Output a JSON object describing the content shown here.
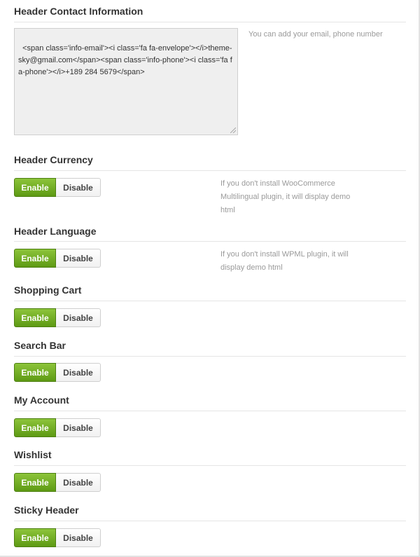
{
  "contact": {
    "title": "Header Contact Information",
    "textarea_value": "<span class='info-email'><i class='fa fa-envelope'></i>theme-sky@gmail.com</span><span class='info-phone'><i class='fa fa-phone'></i>+189 284 5679</span>",
    "help": "You can add your email, phone number"
  },
  "toggle_labels": {
    "enable": "Enable",
    "disable": "Disable"
  },
  "sections": [
    {
      "title": "Header Currency",
      "help_lines": [
        "If you don't install WooCommerce",
        "Multilingual plugin, it will display demo",
        "html"
      ],
      "selected": "Enable"
    },
    {
      "title": "Header Language",
      "help_lines": [
        "If you don't install WPML plugin, it will",
        "display demo html"
      ],
      "selected": "Enable"
    },
    {
      "title": "Shopping Cart",
      "selected": "Enable"
    },
    {
      "title": "Search Bar",
      "selected": "Enable"
    },
    {
      "title": "My Account",
      "selected": "Enable"
    },
    {
      "title": "Wishlist",
      "selected": "Enable"
    },
    {
      "title": "Sticky Header",
      "selected": "Enable"
    }
  ],
  "colors": {
    "enable_bg": "#6aa81c",
    "text": "#333333",
    "help_text": "#9a9a9a"
  }
}
